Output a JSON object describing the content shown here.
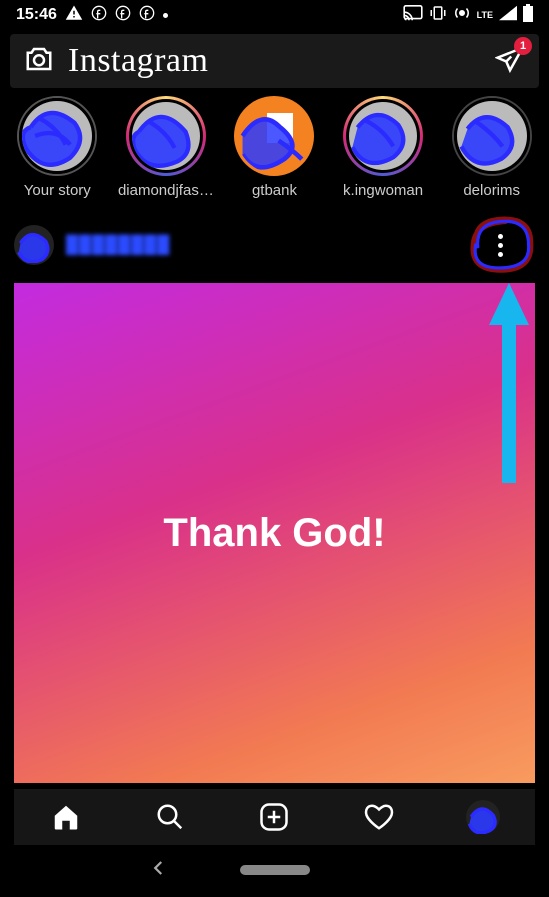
{
  "statusbar": {
    "time": "15:46",
    "lte": "LTE"
  },
  "topbar": {
    "brand": "Instagram",
    "badge": "1"
  },
  "stories": {
    "items": [
      {
        "label": "Your story",
        "ring": "grey"
      },
      {
        "label": "diamondjfas…",
        "ring": "ig"
      },
      {
        "label": "gtbank",
        "ring": "orange"
      },
      {
        "label": "k.ingwoman",
        "ring": "ig"
      },
      {
        "label": "delorims",
        "ring": "none"
      }
    ]
  },
  "post": {
    "media_text": "Thank God!"
  }
}
